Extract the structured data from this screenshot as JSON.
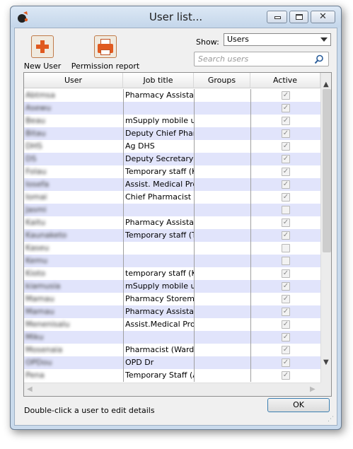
{
  "window": {
    "title": "User list..."
  },
  "toolbar": {
    "new_user_label": "New User",
    "permission_report_label": "Permission report"
  },
  "filter": {
    "show_label": "Show:",
    "show_value": "Users",
    "search_placeholder": "Search users"
  },
  "table": {
    "columns": [
      "User",
      "Job title",
      "Groups",
      "Active"
    ],
    "rows": [
      {
        "user": "Abtmsa",
        "job": "Pharmacy Assistant",
        "groups": "",
        "active": true
      },
      {
        "user": "Asewu",
        "job": "",
        "groups": "",
        "active": true
      },
      {
        "user": "Beau",
        "job": "mSupply mobile user",
        "groups": "",
        "active": true
      },
      {
        "user": "Bitau",
        "job": "Deputy Chief Pharmacist",
        "groups": "",
        "active": true
      },
      {
        "user": "DHS",
        "job": "Ag DHS",
        "groups": "",
        "active": true
      },
      {
        "user": "DS",
        "job": "Deputy Secretary, MoH",
        "groups": "",
        "active": true
      },
      {
        "user": "Folau",
        "job": "Temporary staff (Ka",
        "groups": "",
        "active": true
      },
      {
        "user": "Iosefa",
        "job": "Assist. Medical Pro",
        "groups": "",
        "active": true
      },
      {
        "user": "Iomai",
        "job": "Chief Pharmacist",
        "groups": "",
        "active": true
      },
      {
        "user": "Jasmi",
        "job": "",
        "groups": "",
        "active": false
      },
      {
        "user": "Kaitu",
        "job": "Pharmacy Assistant",
        "groups": "",
        "active": true
      },
      {
        "user": "Kaunaketo",
        "job": "Temporary staff (Ta",
        "groups": "",
        "active": true
      },
      {
        "user": "Kaseu",
        "job": "",
        "groups": "",
        "active": false
      },
      {
        "user": "Kemu",
        "job": "",
        "groups": "",
        "active": false
      },
      {
        "user": "Kioto",
        "job": "temporary staff (Ke",
        "groups": "",
        "active": true
      },
      {
        "user": "kiamusia",
        "job": "mSupply mobile user",
        "groups": "",
        "active": true
      },
      {
        "user": "Mamau",
        "job": "Pharmacy Storeman",
        "groups": "",
        "active": true
      },
      {
        "user": "Mamau",
        "job": "Pharmacy Assistant",
        "groups": "",
        "active": true
      },
      {
        "user": "Menenisalu",
        "job": "Assist.Medical Proc",
        "groups": "",
        "active": true
      },
      {
        "user": "Miku",
        "job": "",
        "groups": "",
        "active": true
      },
      {
        "user": "Mosenaia",
        "job": "Pharmacist (Wards,",
        "groups": "",
        "active": true
      },
      {
        "user": "OPDou",
        "job": "OPD Dr",
        "groups": "",
        "active": true
      },
      {
        "user": "Pena",
        "job": "Temporary Staff (As",
        "groups": "",
        "active": true
      }
    ]
  },
  "footer": {
    "hint": "Double-click a user to edit details",
    "ok_label": "OK"
  },
  "icons": {
    "app": "app-logo-icon",
    "new_user": "plus-icon",
    "permission_report": "printer-icon",
    "search": "search-icon",
    "check": "✓"
  },
  "colors": {
    "row_alt": "#e1e4fb",
    "window_frame": "#c9daec",
    "accent_orange": "#e05a20",
    "ok_border": "#3c7fb1"
  }
}
